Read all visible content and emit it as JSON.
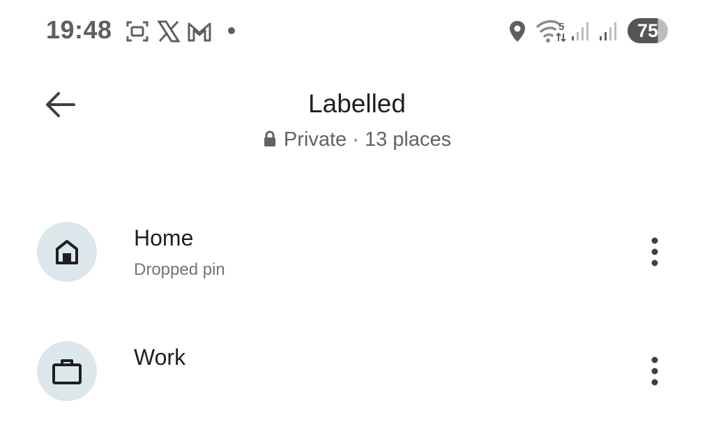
{
  "status_bar": {
    "time": "19:48",
    "notification_icons": [
      "screenshot-icon",
      "x-app-icon",
      "gmail-icon",
      "dot-icon"
    ],
    "system_icons": [
      "location-pin-icon",
      "wifi-icon",
      "signal-icon",
      "signal-icon"
    ],
    "wifi_badge": "5",
    "battery_level": "75"
  },
  "header": {
    "title": "Labelled",
    "visibility": "Private",
    "separator": "·",
    "place_count": "13 places"
  },
  "places": [
    {
      "name": "Home",
      "detail": "Dropped pin",
      "icon": "home-icon"
    },
    {
      "name": "Work",
      "detail": "",
      "icon": "briefcase-icon"
    }
  ],
  "colors": {
    "avatar_bg": "#dce7ec",
    "text_primary": "#1f1f1f",
    "text_secondary": "#5f6368",
    "status_icons": "#5f5f5f"
  }
}
